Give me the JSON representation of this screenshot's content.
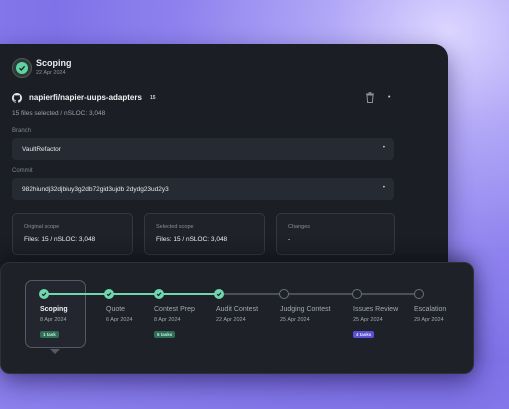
{
  "header": {
    "title": "Scoping",
    "date": "22 Apr 2024"
  },
  "repo": {
    "name": "napierfi/napier-uups-adapters",
    "count": "15",
    "files_selected": "15 files selected / nSLOC: 3,048"
  },
  "branch": {
    "label": "Branch",
    "value": "VaultRefactor"
  },
  "commit": {
    "label": "Commit",
    "value": "982hiundj32djbiuy3g2db72gid3ujdb 2dydg23ud2y3"
  },
  "scope": {
    "original": {
      "label": "Original scope",
      "value": "Files: 15 / nSLOC: 3,048"
    },
    "selected": {
      "label": "Selected scope",
      "value": "Files: 15 / nSLOC: 3,048"
    },
    "changes": {
      "label": "Changes",
      "value": "-"
    }
  },
  "timeline": [
    {
      "name": "Scoping",
      "date": "8 Apr 2024",
      "status": "done",
      "badge": "1 task"
    },
    {
      "name": "Quote",
      "date": "6 Apr 2024",
      "status": "done",
      "badge": ""
    },
    {
      "name": "Contest Prep",
      "date": "8 Apr 2024",
      "status": "done",
      "badge": "5 tasks"
    },
    {
      "name": "Audit Contest",
      "date": "22 Apr 2024",
      "status": "done",
      "badge": ""
    },
    {
      "name": "Judging Contest",
      "date": "25 Apr 2024",
      "status": "todo",
      "badge": ""
    },
    {
      "name": "Issues Review",
      "date": "25 Apr 2024",
      "status": "todo",
      "badge": "4 tasks"
    },
    {
      "name": "Escalation",
      "date": "29 Apr 2024",
      "status": "todo",
      "badge": ""
    }
  ],
  "colors": {
    "accent": "#6fd7ad",
    "purple_badge": "#6c5ce7",
    "background": "#8f82ee"
  },
  "icons": {
    "header": "check-circle-icon",
    "repo": "github-icon",
    "trash": "trash-icon"
  }
}
